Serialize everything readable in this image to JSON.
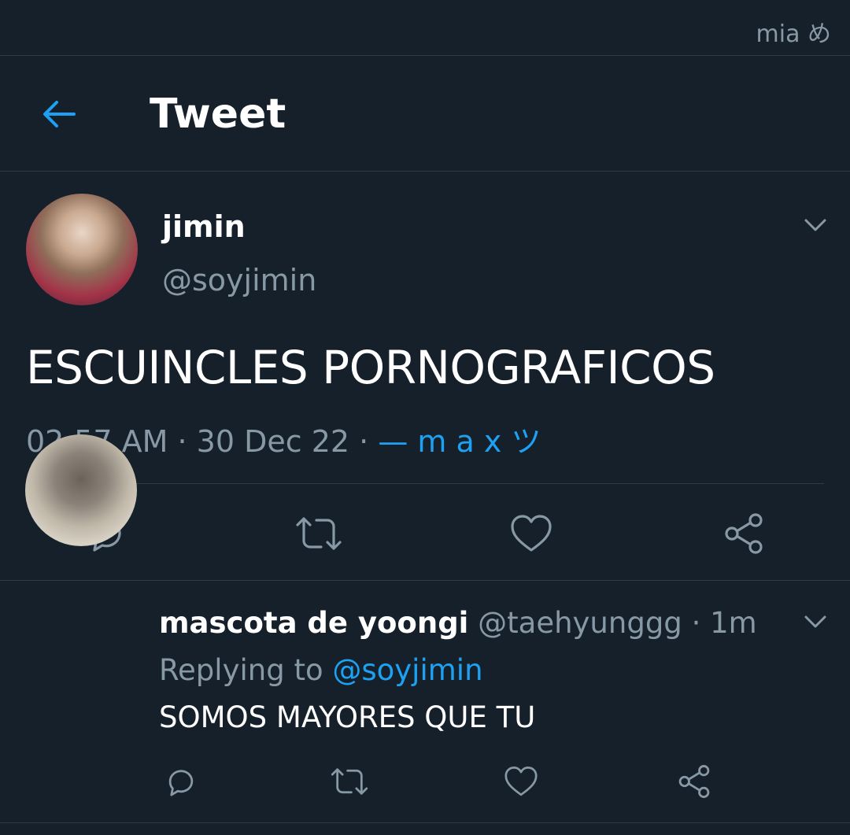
{
  "status_bar": {
    "text": "mia め"
  },
  "header": {
    "title": "Tweet",
    "back_icon": "arrow-left-icon"
  },
  "colors": {
    "background": "#16202b",
    "accent": "#1da1f2",
    "secondary_text": "#8899a6",
    "divider": "#2f3b48"
  },
  "tweet": {
    "name": "jimin",
    "handle": "@soyjimin",
    "text": "ESCUINCLES PORNOGRAFICOS",
    "time": "02:57 AM",
    "date": "30 Dec 22",
    "separator": "·",
    "source": "— m a x ツ",
    "actions": [
      "reply-icon",
      "retweet-icon",
      "like-icon",
      "share-icon"
    ]
  },
  "reply": {
    "name": "mascota de yoongi",
    "handle": "@taehyunggg",
    "time": "1m",
    "replying_label": "Replying to",
    "replying_to": "@soyjimin",
    "text": "SOMOS MAYORES QUE TU",
    "actions": [
      "reply-icon",
      "retweet-icon",
      "like-icon",
      "share-icon"
    ]
  }
}
